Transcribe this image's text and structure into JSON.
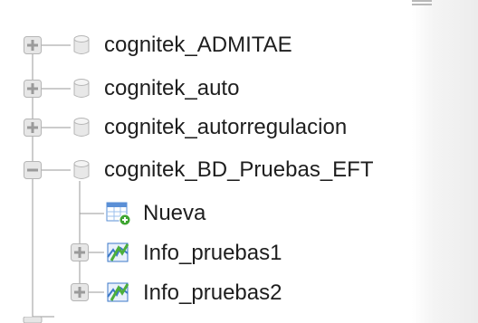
{
  "tree": {
    "databases": [
      {
        "label": "cognitek_ADMITAE",
        "expanded": false,
        "icon": "database-icon"
      },
      {
        "label": "cognitek_auto",
        "expanded": false,
        "icon": "database-icon"
      },
      {
        "label": "cognitek_autorregulacion",
        "expanded": false,
        "icon": "database-icon"
      },
      {
        "label": "cognitek_BD_Pruebas_EFT",
        "expanded": true,
        "icon": "database-icon"
      }
    ],
    "children": [
      {
        "label": "Nueva",
        "icon": "new-table-icon"
      },
      {
        "label": "Info_pruebas1",
        "icon": "view-icon",
        "expandable": true
      },
      {
        "label": "Info_pruebas2",
        "icon": "view-icon",
        "expandable": true
      }
    ]
  },
  "colors": {
    "line": "#9a9a9a",
    "toggle_fill": "#e6e6e6",
    "toggle_border": "#b5b5b5",
    "db_fill": "#e8e8e8",
    "view_green": "#4caf3a",
    "view_blue": "#3c78c8",
    "table_blue": "#5a8fd6",
    "add_green": "#3ea531"
  }
}
